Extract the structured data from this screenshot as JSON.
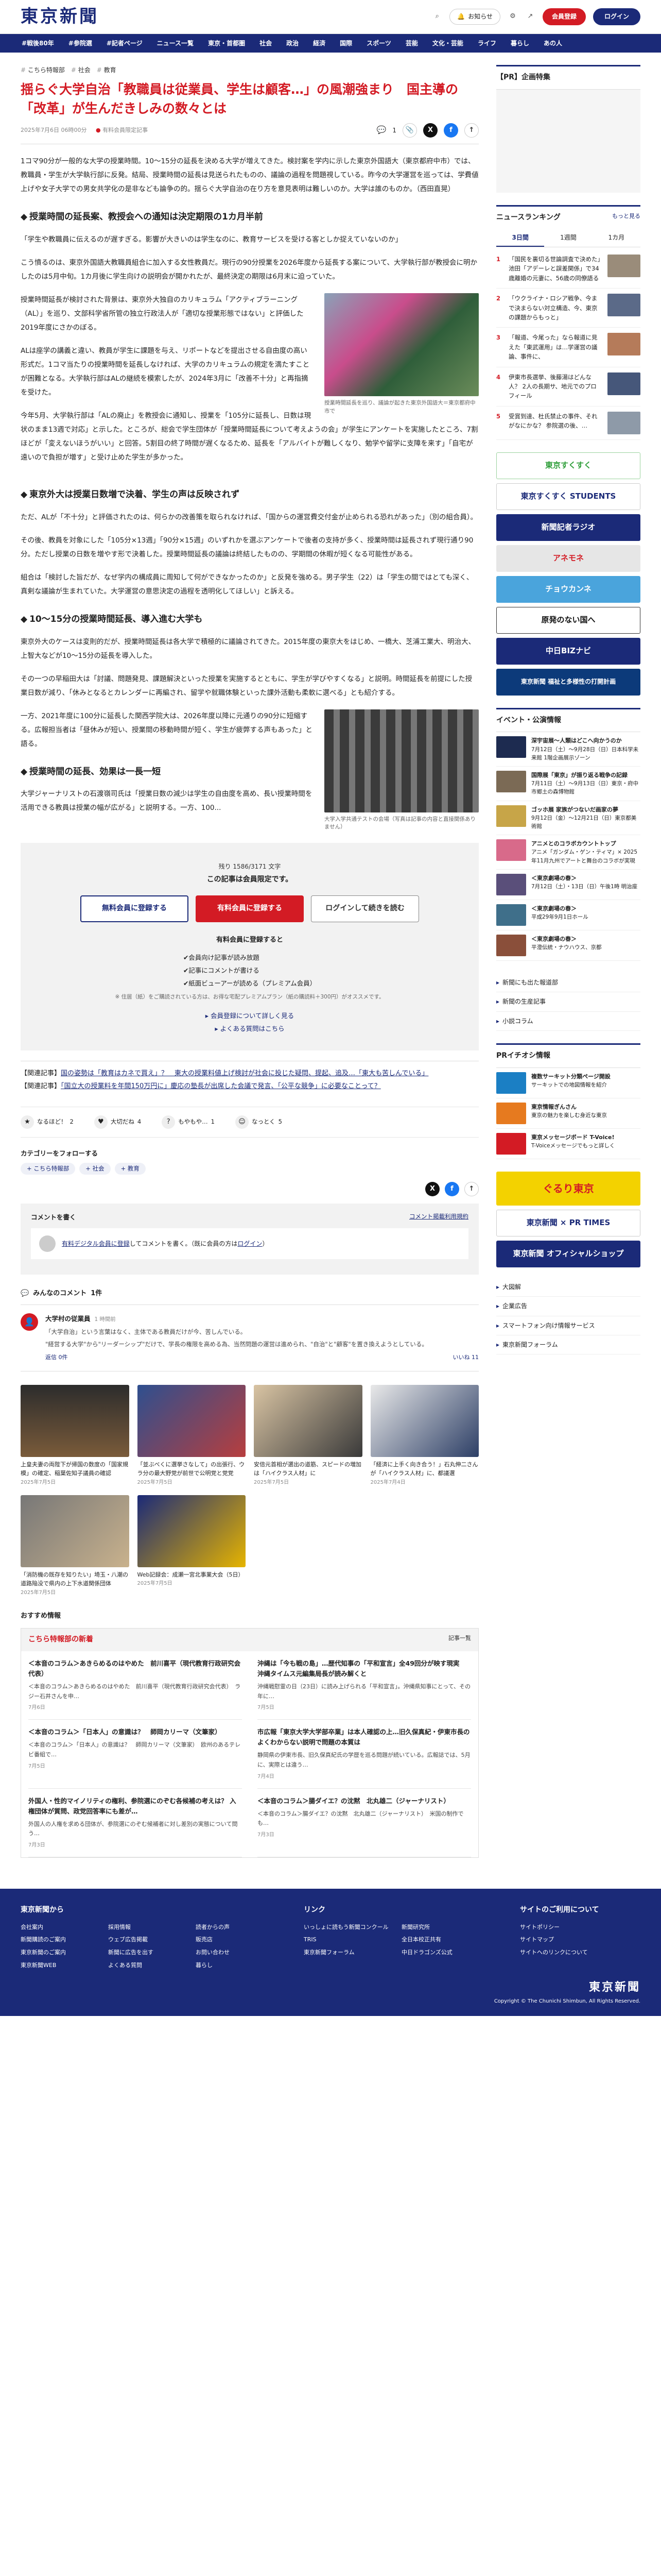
{
  "header": {
    "logo": "東京新聞",
    "notify": "お知らせ",
    "register": "会員登録",
    "login": "ログイン"
  },
  "nav": [
    "#戦後80年",
    "#参院選",
    "#記者ページ",
    "ニュース一覧",
    "東京・首都圏",
    "社会",
    "政治",
    "経済",
    "国際",
    "スポーツ",
    "芸能",
    "文化・芸能",
    "ライフ",
    "暮らし",
    "あの人"
  ],
  "article": {
    "crumbs": [
      "こちら特報部",
      "社会",
      "教育"
    ],
    "title": "揺らぐ大学自治「教職員は従業員、学生は顧客…」の風潮強まり　国主導の「改革」が生んだきしみの数々とは",
    "date": "2025年7月6日 06時00分",
    "byline": "有料会員限定記事",
    "comment_count": "1",
    "lead": "1コマ90分が一般的な大学の授業時間。10〜15分の延長を決める大学が増えてきた。検討案を学内に示した東京外国語大（東京都府中市）では、教職員・学生が大学執行部に反発。結局、授業時間の延長は見送られたものの、議論の過程を問題視している。昨今の大学運営を巡っては、学費値上げや女子大学での男女共学化の是非なども論争の的。揺らぐ大学自治の在り方を意見表明は難しいのか。大学は誰のものか。（西田直晃）",
    "h_1": "授業時間の延長案、教授会への通知は決定期限の1カ月半前",
    "quote_1": "「学生や教職員に伝えるのが遅すぎる。影響が大きいのは学生なのに、教育サービスを受ける客としか捉えていないのか」",
    "p_1": "こう憤るのは、東京外国語大教職員組合に加入する女性教員だ。現行の90分授業を2026年度から延長する案について、大学執行部が教授会に明かしたのは5月中旬。1カ月後に学生向けの説明会が開かれたが、最終決定の期限は6月末に迫っていた。",
    "p_2": "授業時間延長が検討された背景は、東京外大独自のカリキュラム「アクティブラーニング（AL）」を巡り、文部科学省所管の独立行政法人が「適切な授業形態ではない」と評価した2019年度にさかのぼる。",
    "fig_1": "授業時間延長を巡り、議論が起きた東京外国語大＝東京都府中市で",
    "p_3": "ALは座学の講義と違い、教員が学生に課題を与え、リポートなどを提出させる自由度の高い形式だ。1コマ当たりの授業時間を延長しなければ、大学のカリキュラムの規定を満たすことが困難となる。大学執行部はALの継続を模索したが、2024年3月に「改善不十分」と再指摘を受けた。",
    "p_4": "今年5月、大学執行部は「ALの廃止」を教授会に通知し、授業を「105分に延長し、日数は現状のまま13週で対応」と示した。ところが、総会で学生団体が「授業時間延長について考えようの会」が学生にアンケートを実施したところ、7割ほどが「変えないほうがいい」と回答。5割目の終了時間が遅くなるため、延長を「アルバイトが難しくなり、勉学や留学に支障を来す」「自宅が遠いので負担が増す」と受け止めた学生が多かった。",
    "h_2": "東京外大は授業日数増で決着、学生の声は反映されず",
    "p_5": "ただ、ALが「不十分」と評価されたのは、何らかの改善策を取られなければ、「国からの運営費交付金が止められる恐れがあった」（別の組合員）。",
    "p_6": "その後、教員を対象にした「105分×13週」「90分×15週」のいずれかを選ぶアンケートで後者の支持が多く、授業時間は延長されず現行通り90分。ただし授業の日数を増やす形で決着した。授業時間延長の議論は終結したものの、学期間の休暇が短くなる可能性がある。",
    "p_7": "組合は「検討した旨だが、なぜ学内の構成員に周知して何ができなかったのか」と反発を強める。男子学生（22）は「学生の間ではとても深く、真剣な議論が生まれていた。大学運営の意思決定の過程を透明化してほしい」と訴える。",
    "h_3": "10〜15分の授業時間延長、導入進む大学も",
    "p_8": "東京外大のケースは変則的だが、授業時間延長は各大学で積極的に議論されてきた。2015年度の東京大をはじめ、一橋大、芝浦工業大、明治大、上智大などが10〜15分の延長を導入した。",
    "p_9": "その一つの早稲田大は「討議、問題発見、課題解決といった授業を実施するとともに、学生が学びやすくなる」と説明。時間延長を前提にした授業日数が減り、「休みとなるとカレンダーに再編され、留学や就職体験といった課外活動も柔軟に選べる」とも紹介する。",
    "p_10": "一方、2021年度に100分に延長した関西学院大は、2026年度以降に元通りの90分に短縮する。広報担当者は「昼休みが短い、授業間の移動時間が短く、学生が疲弊する声もあった」と語る。",
    "fig_2": "大学入学共通テストの会場（写真は記事の内容と直接関係ありません）",
    "h_4": "授業時間の延長、効果は一長一短",
    "p_11": "大学ジャーナリストの石渡嶺司氏は「授業日数の減少は学生の自由度を高め、長い授業時間を活用できる教員は授業の幅が広がる」と説明する。一方、100..."
  },
  "paywall": {
    "remaining": "残り 1586/3171 文字",
    "title": "この記事は会員限定です。",
    "free_btn": "無料会員に登録する",
    "paid_btn": "有料会員に登録する",
    "login_btn": "ログインして続きを読む",
    "sub_title": "有料会員に登録すると",
    "benefits": [
      "会員向け記事が読み放題",
      "記事にコメントが書ける",
      "紙面ビューアーが読める（プレミアム会員）"
    ],
    "note": "※ 住居（紙）をご購読されている方は、お得な宅配プレミアムプラン（紙の購読料＋300円）がオススメです。",
    "link1": "会員登録について詳しく見る",
    "link2": "よくある質問はこちら"
  },
  "related": [
    {
      "label": "【関連記事】",
      "text": "国の姿勢は「教育はカネで買え」？　東大の授業料値上げ検討が社会に投じた疑問、提起、追及…「東大も苦しんでいる」"
    },
    {
      "label": "【関連記事】",
      "text": "「国立大の授業料を年間150万円に」慶応の塾長が出席した会議で発言、「公平な競争」に必要なことって？"
    }
  ],
  "reactions": [
    {
      "icon": "★",
      "label": "なるほど！",
      "n": "2"
    },
    {
      "icon": "♥",
      "label": "大切だね",
      "n": "4"
    },
    {
      "icon": "?",
      "label": "もやもや…",
      "n": "1"
    },
    {
      "icon": "☺",
      "label": "なっとく",
      "n": "5"
    }
  ],
  "category": {
    "title": "カテゴリーをフォローする",
    "tags": [
      "こちら特報部",
      "社会",
      "教育"
    ]
  },
  "comments_box": {
    "title": "コメントを書く",
    "policy": "コメント掲載利用規約",
    "prompt_link": "有料デジタル会員に登録",
    "prompt_text": "してコメントを書く。（既に会員の方は",
    "login": "ログイン",
    "tail": "）"
  },
  "my_comments": {
    "title": "みんなのコメント",
    "count": "1件"
  },
  "comment": {
    "name": "大学村の従業員",
    "time": "1 時間前",
    "text1": "「大学自治」という言葉はなく、主体である教員だけが今、苦しんでいる。",
    "text2": "\"経営する大学\"から\"リーダーシップ\"だけで、学長の権限を高める為、当然問題の運営は進められ、\"自治\"と\"顧客\"を置き換えようとしている。",
    "reply": "返信 0件",
    "like": "いいね 11"
  },
  "cards": [
    {
      "t": "上皇夫妻の両陛下が帰国の数度の「国家規模」の確定、稲葉佐知子議員の確認",
      "d": "2025年7月5日"
    },
    {
      "t": "「並ぶべくに選挙さなして」の出張行、ウラ分の最大野党が前世で公明党と党党",
      "d": "2025年7月5日"
    },
    {
      "t": "安倍元首相が選出の道筋、スピードの増加は「ハイクラス人材」に",
      "d": "2025年7月5日"
    },
    {
      "t": "「経済に上手く向き合う！」石丸伸二さんが「ハイクラス人材」に、都議選",
      "d": "2025年7月4日"
    },
    {
      "t": "「消防機の既存を知りたい」埼玉・八潮の道路陥没で県内の上下水道関係団体",
      "d": "2025年7月5日"
    },
    {
      "t": "Web記録会：成瀬一宮北事業大会（5日）",
      "d": "2025年7月5日"
    }
  ],
  "recommend": "おすすめ情報",
  "tokuho": {
    "title": "こちら特報部の新着",
    "more": "記事一覧",
    "items": [
      {
        "t": "＜本音のコラム＞あきらめるのはやめた　前川喜平（現代教育行政研究会代表）",
        "b": "＜本音のコラム＞あきらめるのはやめた　前川喜平（現代教育行政研究会代表）　ラジー石井さんを申…",
        "d": "7月6日"
      },
      {
        "t": "沖縄は「今も戦の島」…歴代知事の「平和宣言」全49回分が映す現実　沖縄タイムス元編集局長が読み解くと",
        "b": "沖縄戦慰霊の日（23日）に読み上げられる「平和宣言」。沖縄県知事にとって、その年に…",
        "d": "7月5日"
      },
      {
        "t": "＜本音のコラム＞「日本人」の意識は？　師岡カリーマ（文筆家）",
        "b": "＜本音のコラム＞「日本人」の意識は？　師岡カリーマ（文筆家）　欧州のあるテレビ番組で…",
        "d": "7月5日"
      },
      {
        "t": "市広報「東京大学大学部卒業」は本人確認の上…旧久保真紀・伊東市長のよくわからない説明で問題の本質は",
        "b": "静岡県の伊東市長、旧久保真紀氏の学歴を巡る問題が続いている。広報誌では、5月に、実際とは違う…",
        "d": "7月4日"
      },
      {
        "t": "外国人・性的マイノリティの権利、参院選にのぞむ各候補の考えは？ 入権団体が質問、政党回答率にも差が…",
        "b": "外国人の人権を求める団体が、参院選にのぞむ候補者に対し差別の実態について問う…",
        "d": "7月3日"
      },
      {
        "t": "＜本音のコラム＞腸ダイエ？の沈黙　北丸雄二（ジャーナリスト）",
        "b": "＜本音のコラム＞腸ダイエ？の沈黙　北丸雄二（ジャーナリスト）　米国の制作でも…",
        "d": "7月3日"
      }
    ]
  },
  "sidebar": {
    "pr": "【PR】企画特集",
    "ranking": {
      "title": "ニュースランキング",
      "more": "もっと見る",
      "tabs": [
        "3日間",
        "1週間",
        "1カ月"
      ],
      "items": [
        "「国民を裏切る世論調査で決めた」池田「アデーレと誤差関係」で34歳離婚の元妻に、56歳の同僚語る",
        "「ウクライナ・ロシア戦争、今まで決まらない対立構造、今、東京の課題からもっと」",
        "「報道、今尾った」なら報道に見えた「東武運用」は…学運営の議論、事件に、",
        "伊東市長選挙、後藤湯はどんな人？ 2人の長期サ、地元でのプロフィール",
        "受賞到達、杜氏禁止の事件、それがなにかな？ 参院選の後、…"
      ]
    },
    "ads": [
      "東京すくすく",
      "東京すくすく STUDENTS",
      "新聞記者ラジオ",
      "アネモネ",
      "チョウカンネ",
      "原発のない国へ",
      "中日BIZナビ",
      "東京新聞 福祉と多様性の打開計画"
    ],
    "events": {
      "title": "イベント・公演情報",
      "items": [
        {
          "b": "深宇宙展〜人類はどこへ向かうのか",
          "t": "7月12日（土）〜9月28日（日）日本科学未来館 1階企画展示ゾーン"
        },
        {
          "b": "国際展「東京」が振り返る戦争の記録",
          "t": "7月11日（土）〜9月13日（日）東京・府中市郷土の森博物館"
        },
        {
          "b": "ゴッホ展 家族がつないだ画家の夢",
          "t": "9月12日（金）〜12月21日（日）東京都美術館"
        },
        {
          "b": "アニメとのコラボカウントトップ",
          "t": "アニメ「ガンダム・ゲン・ティマ」× 2025年11月九州でアートと舞台のコラボが実現"
        },
        {
          "b": "＜東京劇場の春＞",
          "t": "7月12日（土）・13日（日）午後1時 明治座"
        },
        {
          "b": "＜東京劇場の春＞",
          "t": "平成29年9月1日ホール"
        },
        {
          "b": "＜東京劇場の春＞",
          "t": "平澄伝統・ナウハウス、京都"
        }
      ]
    },
    "links1": [
      "新聞にも出た報道部",
      "新聞の生産記事",
      "小説コラム"
    ],
    "pr2": {
      "title": "PRイチオシ情報",
      "items": [
        {
          "b": "複数サーキット分類ページ開設",
          "t": "サーキットでの地図情報を紹介"
        },
        {
          "b": "東京情報ぎんさん",
          "t": "東京の魅力を楽しむ身近な東京"
        },
        {
          "b": "東京メッセージボード T-Voice!",
          "t": "T-Voiceメッセージでもっと詳しく"
        }
      ]
    },
    "ads2": [
      "ぐるり東京",
      "東京新聞 × PR TIMES",
      "東京新聞 オフィシャルショップ"
    ],
    "links2": [
      "大図解",
      "企業広告",
      "スマートフォン向け情報サービス",
      "東京新聞フォーラム"
    ]
  },
  "footer": {
    "col1": {
      "title": "東京新聞から",
      "items": [
        "会社案内",
        "採用情報",
        "読者からの声",
        "新聞購読のご案内",
        "ウェブ広告掲載",
        "販売店",
        "東京新聞のご案内",
        "新聞に広告を出す",
        "お問い合わせ",
        "東京新聞WEB",
        "よくある質問",
        "暮らし"
      ]
    },
    "col2": {
      "title": "リンク",
      "items": [
        "いっしょに読もう新聞コンクール",
        "新聞研究所",
        "TRIS",
        "全日本校正共有",
        "東京新聞フォーラム",
        "中日ドラゴンズ公式"
      ]
    },
    "col3": {
      "title": "サイトのご利用について",
      "items": [
        "サイトポリシー",
        "サイトマップ",
        "サイトへのリンクについて"
      ]
    },
    "logo": "東京新聞",
    "copy": "Copyright © The Chunichi Shimbun, All Rights Reserved."
  }
}
